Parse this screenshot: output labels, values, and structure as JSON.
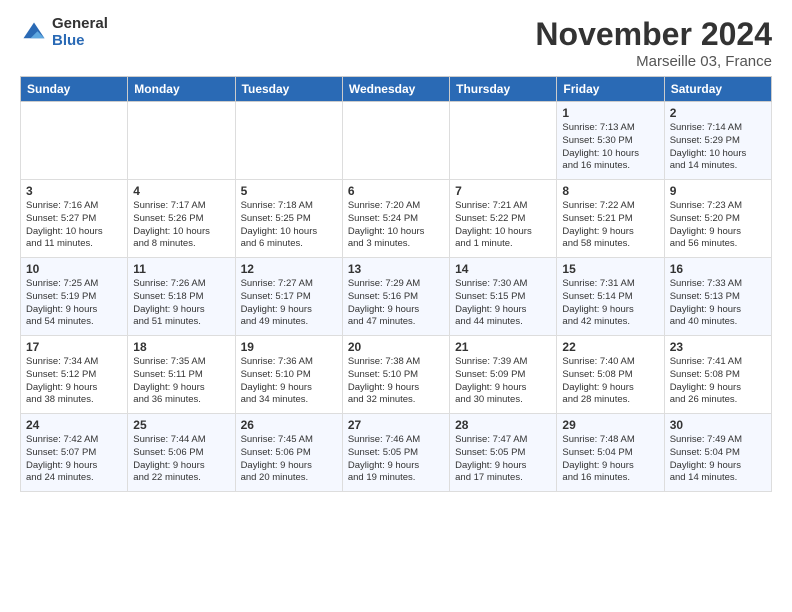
{
  "logo": {
    "general": "General",
    "blue": "Blue"
  },
  "header": {
    "month": "November 2024",
    "location": "Marseille 03, France"
  },
  "weekdays": [
    "Sunday",
    "Monday",
    "Tuesday",
    "Wednesday",
    "Thursday",
    "Friday",
    "Saturday"
  ],
  "weeks": [
    [
      {
        "day": "",
        "text": ""
      },
      {
        "day": "",
        "text": ""
      },
      {
        "day": "",
        "text": ""
      },
      {
        "day": "",
        "text": ""
      },
      {
        "day": "",
        "text": ""
      },
      {
        "day": "1",
        "text": "Sunrise: 7:13 AM\nSunset: 5:30 PM\nDaylight: 10 hours\nand 16 minutes."
      },
      {
        "day": "2",
        "text": "Sunrise: 7:14 AM\nSunset: 5:29 PM\nDaylight: 10 hours\nand 14 minutes."
      }
    ],
    [
      {
        "day": "3",
        "text": "Sunrise: 7:16 AM\nSunset: 5:27 PM\nDaylight: 10 hours\nand 11 minutes."
      },
      {
        "day": "4",
        "text": "Sunrise: 7:17 AM\nSunset: 5:26 PM\nDaylight: 10 hours\nand 8 minutes."
      },
      {
        "day": "5",
        "text": "Sunrise: 7:18 AM\nSunset: 5:25 PM\nDaylight: 10 hours\nand 6 minutes."
      },
      {
        "day": "6",
        "text": "Sunrise: 7:20 AM\nSunset: 5:24 PM\nDaylight: 10 hours\nand 3 minutes."
      },
      {
        "day": "7",
        "text": "Sunrise: 7:21 AM\nSunset: 5:22 PM\nDaylight: 10 hours\nand 1 minute."
      },
      {
        "day": "8",
        "text": "Sunrise: 7:22 AM\nSunset: 5:21 PM\nDaylight: 9 hours\nand 58 minutes."
      },
      {
        "day": "9",
        "text": "Sunrise: 7:23 AM\nSunset: 5:20 PM\nDaylight: 9 hours\nand 56 minutes."
      }
    ],
    [
      {
        "day": "10",
        "text": "Sunrise: 7:25 AM\nSunset: 5:19 PM\nDaylight: 9 hours\nand 54 minutes."
      },
      {
        "day": "11",
        "text": "Sunrise: 7:26 AM\nSunset: 5:18 PM\nDaylight: 9 hours\nand 51 minutes."
      },
      {
        "day": "12",
        "text": "Sunrise: 7:27 AM\nSunset: 5:17 PM\nDaylight: 9 hours\nand 49 minutes."
      },
      {
        "day": "13",
        "text": "Sunrise: 7:29 AM\nSunset: 5:16 PM\nDaylight: 9 hours\nand 47 minutes."
      },
      {
        "day": "14",
        "text": "Sunrise: 7:30 AM\nSunset: 5:15 PM\nDaylight: 9 hours\nand 44 minutes."
      },
      {
        "day": "15",
        "text": "Sunrise: 7:31 AM\nSunset: 5:14 PM\nDaylight: 9 hours\nand 42 minutes."
      },
      {
        "day": "16",
        "text": "Sunrise: 7:33 AM\nSunset: 5:13 PM\nDaylight: 9 hours\nand 40 minutes."
      }
    ],
    [
      {
        "day": "17",
        "text": "Sunrise: 7:34 AM\nSunset: 5:12 PM\nDaylight: 9 hours\nand 38 minutes."
      },
      {
        "day": "18",
        "text": "Sunrise: 7:35 AM\nSunset: 5:11 PM\nDaylight: 9 hours\nand 36 minutes."
      },
      {
        "day": "19",
        "text": "Sunrise: 7:36 AM\nSunset: 5:10 PM\nDaylight: 9 hours\nand 34 minutes."
      },
      {
        "day": "20",
        "text": "Sunrise: 7:38 AM\nSunset: 5:10 PM\nDaylight: 9 hours\nand 32 minutes."
      },
      {
        "day": "21",
        "text": "Sunrise: 7:39 AM\nSunset: 5:09 PM\nDaylight: 9 hours\nand 30 minutes."
      },
      {
        "day": "22",
        "text": "Sunrise: 7:40 AM\nSunset: 5:08 PM\nDaylight: 9 hours\nand 28 minutes."
      },
      {
        "day": "23",
        "text": "Sunrise: 7:41 AM\nSunset: 5:08 PM\nDaylight: 9 hours\nand 26 minutes."
      }
    ],
    [
      {
        "day": "24",
        "text": "Sunrise: 7:42 AM\nSunset: 5:07 PM\nDaylight: 9 hours\nand 24 minutes."
      },
      {
        "day": "25",
        "text": "Sunrise: 7:44 AM\nSunset: 5:06 PM\nDaylight: 9 hours\nand 22 minutes."
      },
      {
        "day": "26",
        "text": "Sunrise: 7:45 AM\nSunset: 5:06 PM\nDaylight: 9 hours\nand 20 minutes."
      },
      {
        "day": "27",
        "text": "Sunrise: 7:46 AM\nSunset: 5:05 PM\nDaylight: 9 hours\nand 19 minutes."
      },
      {
        "day": "28",
        "text": "Sunrise: 7:47 AM\nSunset: 5:05 PM\nDaylight: 9 hours\nand 17 minutes."
      },
      {
        "day": "29",
        "text": "Sunrise: 7:48 AM\nSunset: 5:04 PM\nDaylight: 9 hours\nand 16 minutes."
      },
      {
        "day": "30",
        "text": "Sunrise: 7:49 AM\nSunset: 5:04 PM\nDaylight: 9 hours\nand 14 minutes."
      }
    ]
  ]
}
